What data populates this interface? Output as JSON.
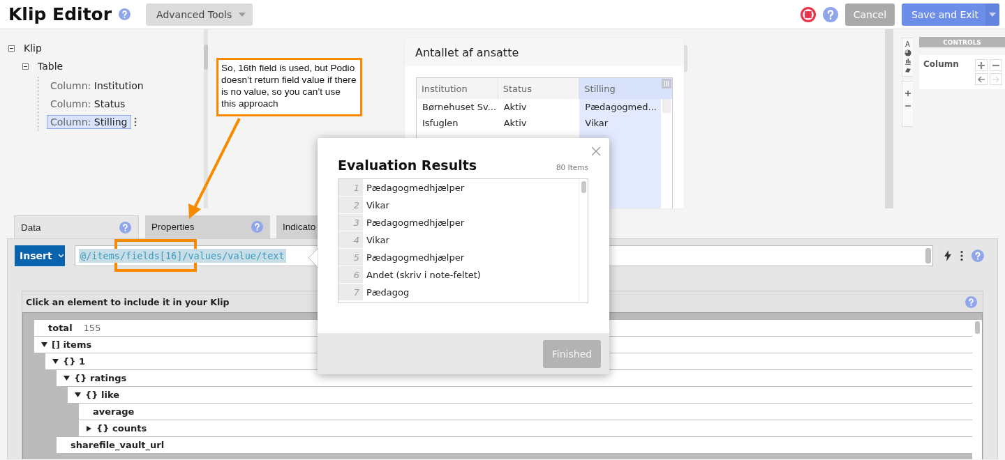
{
  "header": {
    "title": "Klip Editor",
    "tools_menu": "Advanced Tools",
    "cancel": "Cancel",
    "save": "Save and Exit"
  },
  "klip_tree": [
    {
      "label": "Klip",
      "expanded": true,
      "children": [
        {
          "label": "Table",
          "expanded": true,
          "children": [
            {
              "prefix": "Column:",
              "label": "Institution",
              "selected": false
            },
            {
              "prefix": "Column:",
              "label": "Status",
              "selected": false
            },
            {
              "prefix": "Column:",
              "label": "Stilling",
              "selected": true
            }
          ]
        }
      ]
    }
  ],
  "preview": {
    "title": "Antallet af ansatte",
    "columns": [
      {
        "header": "Institution",
        "selected": false,
        "cells": [
          "Børnehuset Sv...",
          "Isfuglen"
        ]
      },
      {
        "header": "Status",
        "selected": false,
        "cells": [
          "Aktiv",
          "Aktiv"
        ]
      },
      {
        "header": "Stilling",
        "selected": true,
        "cells": [
          "Pædagogmed...",
          "Vikar"
        ]
      }
    ]
  },
  "tool_tabs": {
    "text_tool": "A"
  },
  "controls": {
    "title": "CONTROLS",
    "label": "Column",
    "buttons": [
      {
        "kind": "add",
        "disabled": false
      },
      {
        "kind": "remove",
        "disabled": false
      },
      {
        "kind": "move_left",
        "disabled": false
      },
      {
        "kind": "move_right",
        "disabled": true
      }
    ]
  },
  "tabs": [
    {
      "label": "Data",
      "selected": true,
      "help": true
    },
    {
      "label": "Properties",
      "selected": false,
      "help": true
    },
    {
      "label": "Indicato",
      "selected": false
    }
  ],
  "formula": {
    "button": "Insert",
    "value": "@/items/fields[16]/values/value/text"
  },
  "explorer": {
    "heading": "Click an element to include it in your Klip",
    "nodes": [
      {
        "label": "total",
        "value": "155"
      },
      {
        "label": "[] items",
        "expanded": true,
        "children": [
          {
            "label": "{} 1",
            "expanded": true,
            "children": [
              {
                "label": "{} ratings",
                "expanded": true,
                "children": [
                  {
                    "label": "{} like",
                    "expanded": true,
                    "children": [
                      {
                        "label": "average"
                      },
                      {
                        "label": "{} counts",
                        "expanded": false
                      }
                    ]
                  }
                ]
              },
              {
                "label": "sharefile_vault_url"
              }
            ]
          }
        ]
      }
    ]
  },
  "annotation": {
    "note": "So, 16th field is used, but Podio doesn’t return field value if there is no value, so you can’t use this approach"
  },
  "dialog": {
    "title": "Evaluation Results",
    "count": "80 Items",
    "results": [
      {
        "line": "1",
        "text": "Pædagogmedhjælper"
      },
      {
        "line": "2",
        "text": "Vikar"
      },
      {
        "line": "3",
        "text": "Pædagogmedhjælper"
      },
      {
        "line": "4",
        "text": "Vikar"
      },
      {
        "line": "5",
        "text": "Pædagogmedhjælper"
      },
      {
        "line": "6",
        "text": "Andet (skriv i note-feltet)"
      },
      {
        "line": "7",
        "text": "Pædagog"
      }
    ],
    "button": {
      "label": "Finished",
      "disabled": true
    }
  }
}
